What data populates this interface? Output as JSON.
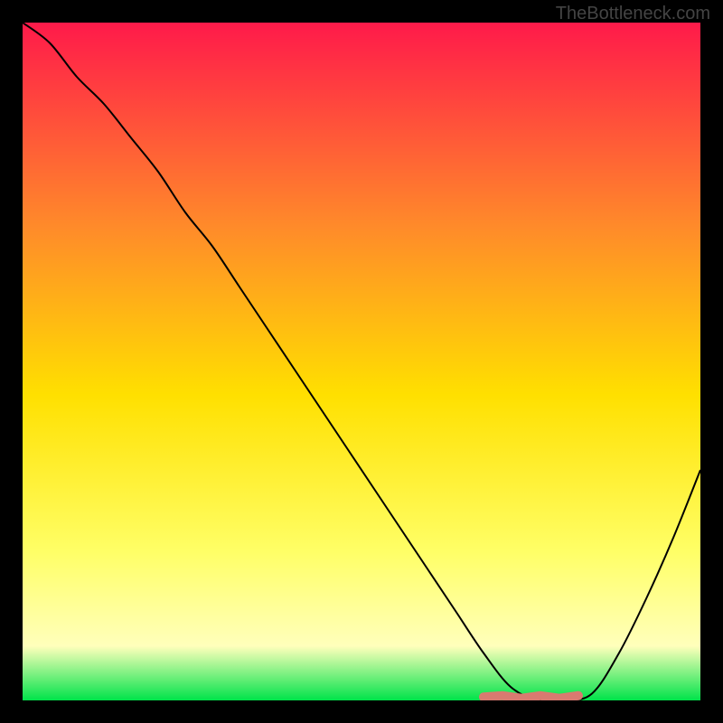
{
  "watermark": "TheBottleneck.com",
  "chart_data": {
    "type": "line",
    "title": "",
    "xlabel": "",
    "ylabel": "",
    "xlim": [
      0,
      100
    ],
    "ylim": [
      0,
      100
    ],
    "background_gradient": {
      "top": "#ff1a4a",
      "mid_upper": "#ff8a2a",
      "mid": "#ffe000",
      "mid_lower": "#ffff66",
      "lower": "#ffffbb",
      "bottom": "#00e34a"
    },
    "series": [
      {
        "name": "bottleneck-curve",
        "color": "#000000",
        "x": [
          0,
          4,
          8,
          12,
          16,
          20,
          24,
          28,
          32,
          36,
          40,
          44,
          48,
          52,
          56,
          60,
          64,
          68,
          72,
          76,
          80,
          84,
          88,
          92,
          96,
          100
        ],
        "y": [
          100,
          97,
          92,
          88,
          83,
          78,
          72,
          67,
          61,
          55,
          49,
          43,
          37,
          31,
          25,
          19,
          13,
          7,
          2,
          0,
          0,
          1,
          7,
          15,
          24,
          34
        ]
      }
    ],
    "highlight": {
      "name": "optimal-range",
      "color": "#d97a70",
      "x_range": [
        68,
        82
      ],
      "y": 0.5
    }
  }
}
